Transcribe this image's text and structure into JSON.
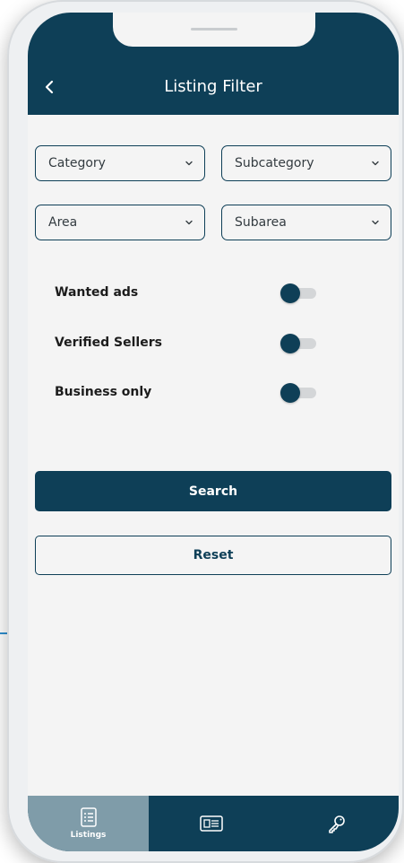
{
  "header": {
    "title": "Listing Filter",
    "back_icon": "chevron-left-icon"
  },
  "filters": {
    "category": {
      "label": "Category",
      "icon": "chevron-down-icon"
    },
    "subcategory": {
      "label": "Subcategory",
      "icon": "chevron-down-icon"
    },
    "area": {
      "label": "Area",
      "icon": "chevron-down-icon"
    },
    "subarea": {
      "label": "Subarea",
      "icon": "chevron-down-icon"
    }
  },
  "toggles": [
    {
      "label": "Wanted ads",
      "state": "off"
    },
    {
      "label": "Verified Sellers",
      "state": "off"
    },
    {
      "label": "Business only",
      "state": "off"
    }
  ],
  "actions": {
    "search_label": "Search",
    "reset_label": "Reset"
  },
  "tabbar": {
    "tabs": [
      {
        "label": "Listings",
        "icon": "list-icon",
        "active": true
      },
      {
        "label": "",
        "icon": "newspaper-icon",
        "active": false
      },
      {
        "label": "",
        "icon": "key-icon",
        "active": false
      }
    ]
  },
  "colors": {
    "primary": "#0e3f57",
    "tab_active": "#7f9ca9",
    "background": "#f4f4f4",
    "accent_line": "#2f8fd0"
  }
}
